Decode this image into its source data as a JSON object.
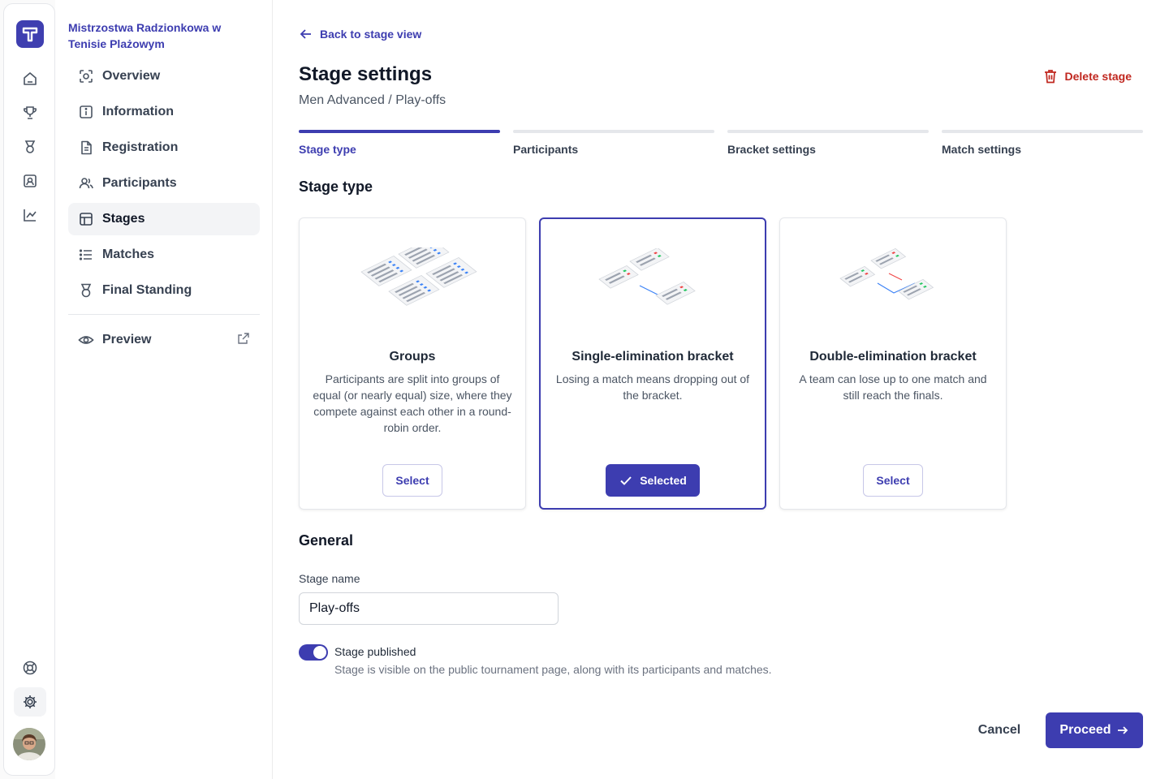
{
  "rail": {
    "icons": [
      "logo-icon",
      "home-icon",
      "trophy-icon",
      "medal-icon",
      "user-badge-icon",
      "chart-icon",
      "help-icon",
      "settings-icon",
      "avatar"
    ]
  },
  "sidebar": {
    "tournament_name": "Mistrzostwa Radzionkowa w Tenisie Plażowym",
    "items": [
      {
        "label": "Overview",
        "icon": "overview-icon"
      },
      {
        "label": "Information",
        "icon": "info-icon"
      },
      {
        "label": "Registration",
        "icon": "document-icon"
      },
      {
        "label": "Participants",
        "icon": "users-icon"
      },
      {
        "label": "Stages",
        "icon": "stages-icon",
        "active": true
      },
      {
        "label": "Matches",
        "icon": "list-icon"
      },
      {
        "label": "Final Standing",
        "icon": "medal-icon"
      }
    ],
    "preview": {
      "label": "Preview",
      "icon": "eye-icon"
    }
  },
  "header": {
    "back_label": "Back to stage view",
    "title": "Stage settings",
    "subtitle": "Men Advanced / Play-offs",
    "delete_label": "Delete stage"
  },
  "steps": [
    {
      "label": "Stage type",
      "active": true
    },
    {
      "label": "Participants",
      "active": false
    },
    {
      "label": "Bracket settings",
      "active": false
    },
    {
      "label": "Match settings",
      "active": false
    }
  ],
  "stage_type": {
    "heading": "Stage type",
    "cards": [
      {
        "title": "Groups",
        "description": "Participants are split into groups of equal (or nearly equal) size, where they compete against each other in a round-robin order.",
        "button": "Select",
        "selected": false
      },
      {
        "title": "Single-elimination bracket",
        "description": "Losing a match means dropping out of the bracket.",
        "button": "Selected",
        "selected": true
      },
      {
        "title": "Double-elimination bracket",
        "description": "A team can lose up to one match and still reach the finals.",
        "button": "Select",
        "selected": false
      }
    ]
  },
  "general": {
    "heading": "General",
    "stage_name_label": "Stage name",
    "stage_name_value": "Play-offs",
    "published_title": "Stage published",
    "published_desc": "Stage is visible on the public tournament page, along with its participants and matches.",
    "published_on": true
  },
  "footer": {
    "cancel_label": "Cancel",
    "proceed_label": "Proceed"
  },
  "colors": {
    "accent": "#3d3db0",
    "danger": "#c0271f"
  }
}
